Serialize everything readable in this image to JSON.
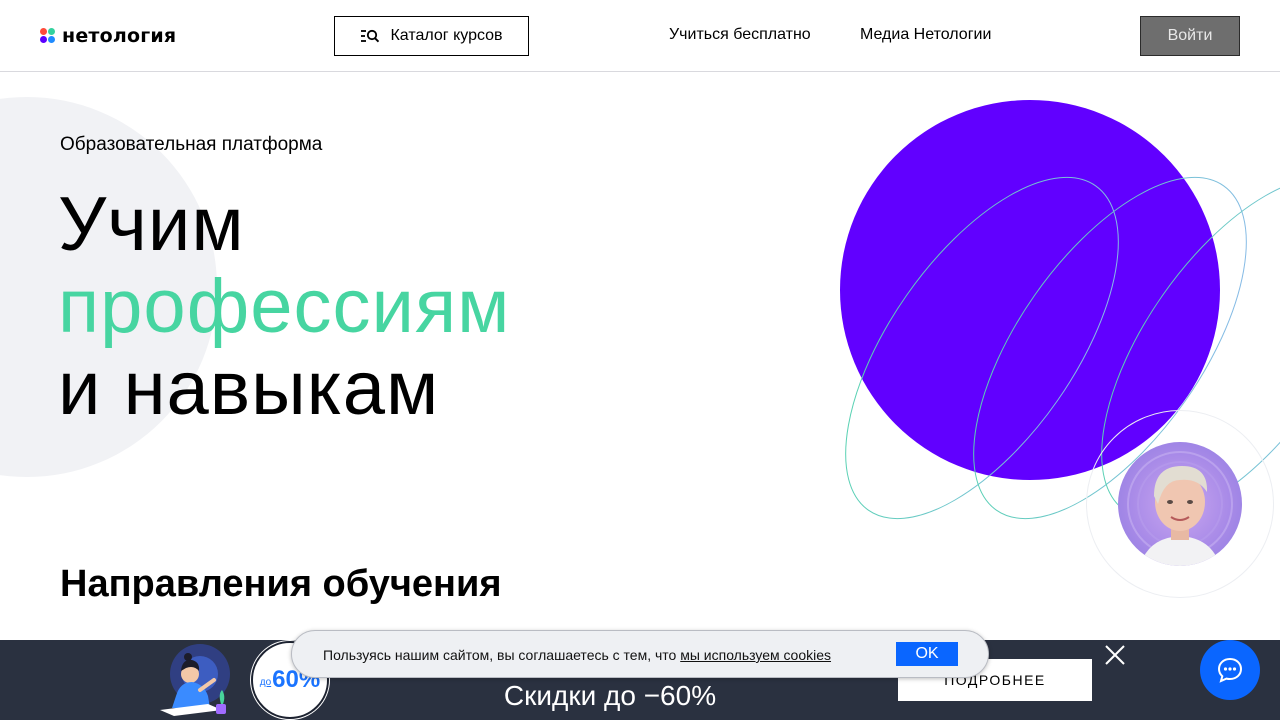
{
  "header": {
    "logo_text": "нетология",
    "catalog_label": "Каталог курсов",
    "nav": [
      {
        "label": "Учиться бесплатно"
      },
      {
        "label": "Медиа Нетологии"
      }
    ],
    "login_label": "Войти"
  },
  "hero": {
    "subtitle": "Образовательная платформа",
    "headline_line1": "Учим",
    "headline_line2": "профессиям",
    "headline_line3": "и навыкам",
    "accent_color": "#47d5a1",
    "circle_color": "#6100ff"
  },
  "section": {
    "title": "Направления обучения"
  },
  "promo": {
    "badge_prefix": "до",
    "badge_value": "60%",
    "title": "Скидки до −60%",
    "more_label": "ПОДРОБНЕЕ",
    "background_color": "#2a3140"
  },
  "cookie": {
    "text": "Пользуясь нашим сайтом, вы соглашаетесь с тем, что ",
    "link_text": "мы используем cookies",
    "ok_label": "OK"
  },
  "icons": {
    "catalog": "catalog-search-icon",
    "close": "close-icon",
    "chat": "chat-icon"
  }
}
